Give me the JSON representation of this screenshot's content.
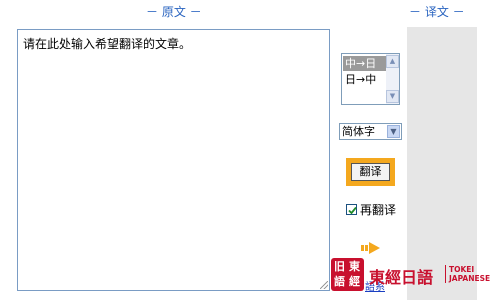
{
  "headers": {
    "source": "－ 原文 －",
    "target": "－ 译文 －"
  },
  "source_input": {
    "value": "请在此处输入希望翻译的文章。"
  },
  "direction_list": {
    "options": [
      "中→日",
      "日→中"
    ],
    "selected_index": 0
  },
  "script_select": {
    "value": "简体字"
  },
  "translate_button": {
    "label": "翻译"
  },
  "retranslate": {
    "label": "再翻译",
    "checked": true
  },
  "logo": {
    "tag_chars": [
      "旧",
      "東",
      "語",
      "經"
    ],
    "main": "東經日語",
    "sub_line1": "TOKEI",
    "sub_line2": "JAPANESE",
    "link": "語系"
  },
  "colors": {
    "header": "#2a64c0",
    "accent_orange": "#f4a81e",
    "logo_red": "#c8102e",
    "target_panel": "#e6e6e6"
  }
}
